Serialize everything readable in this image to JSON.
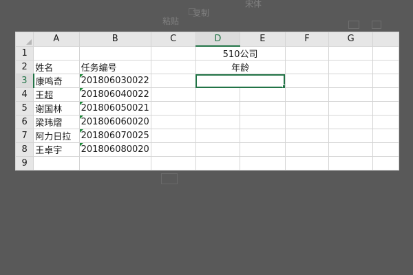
{
  "ribbon": {
    "paste_label": "粘贴",
    "copy_label": "复制",
    "font_name": "宋体"
  },
  "sheet": {
    "columns": [
      "A",
      "B",
      "C",
      "D",
      "E",
      "F",
      "G"
    ],
    "selected_column": "D",
    "rows": [
      "1",
      "2",
      "3",
      "4",
      "5",
      "6",
      "7",
      "8",
      "9"
    ],
    "selected_row": "3",
    "merged_title": "510公司",
    "age_header": "年龄",
    "header_name": "姓名",
    "header_task": "任务编号",
    "records": [
      {
        "name": "康鸣奇",
        "task": "201806030022"
      },
      {
        "name": "王超",
        "task": "201806040022"
      },
      {
        "name": "谢国林",
        "task": "201806050021"
      },
      {
        "name": "梁玮熠",
        "task": "201806060020"
      },
      {
        "name": "阿力日拉",
        "task": "201806070025"
      },
      {
        "name": "王卓宇",
        "task": "201806080020"
      }
    ],
    "active_cell": "D3"
  }
}
